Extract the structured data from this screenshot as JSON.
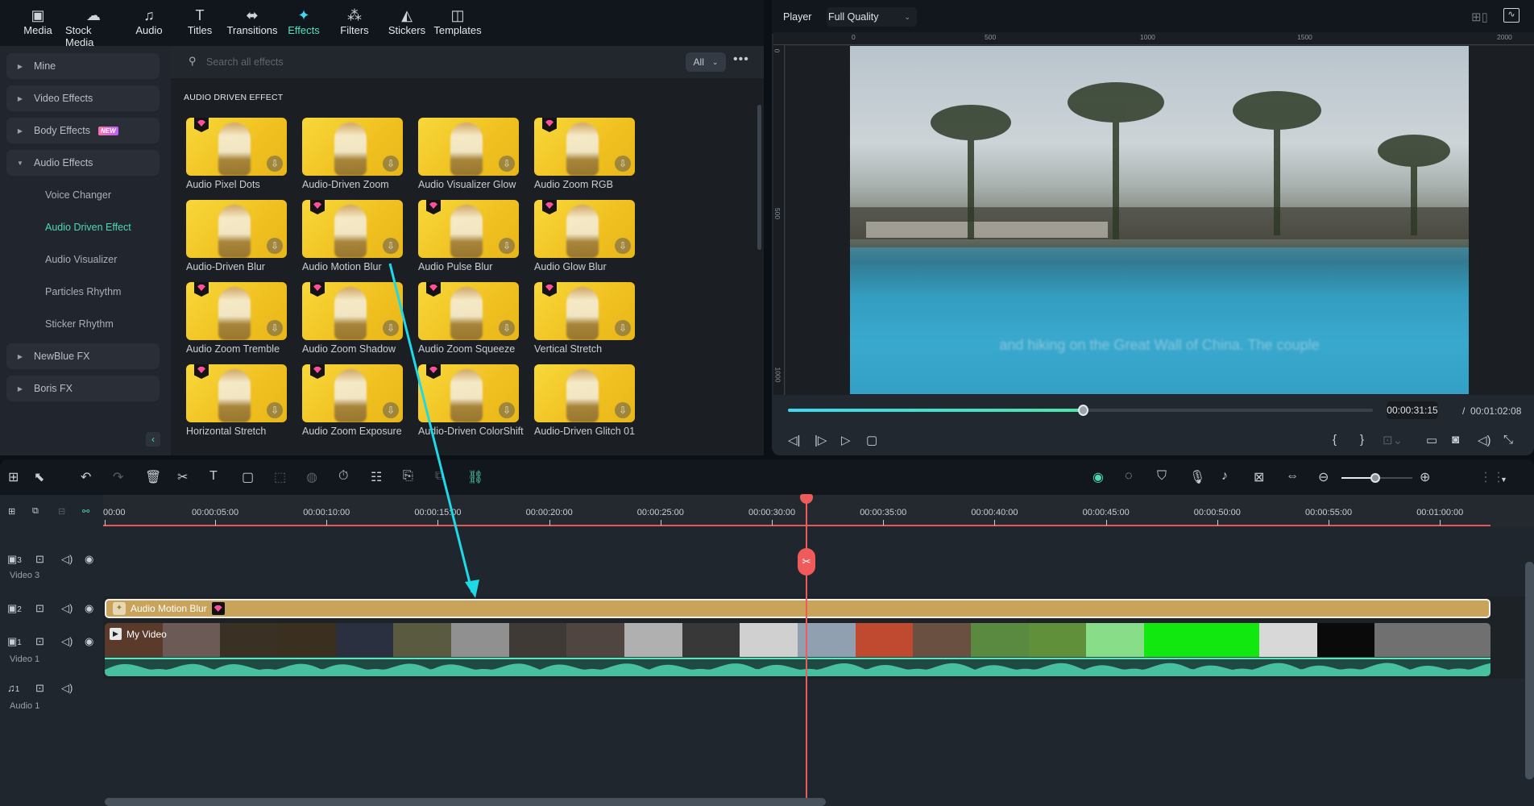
{
  "toolbar": {
    "items": [
      {
        "label": "Media",
        "icon": "media-icon"
      },
      {
        "label": "Stock Media",
        "icon": "stock-media-icon"
      },
      {
        "label": "Audio",
        "icon": "music-note-icon"
      },
      {
        "label": "Titles",
        "icon": "titles-icon"
      },
      {
        "label": "Transitions",
        "icon": "transitions-icon"
      },
      {
        "label": "Effects",
        "icon": "effects-icon",
        "active": true
      },
      {
        "label": "Filters",
        "icon": "filters-icon"
      },
      {
        "label": "Stickers",
        "icon": "stickers-icon"
      },
      {
        "label": "Templates",
        "icon": "templates-icon"
      }
    ]
  },
  "sidebar": {
    "categories": [
      {
        "label": "Mine",
        "expanded": false
      },
      {
        "label": "Video Effects",
        "expanded": false
      },
      {
        "label": "Body Effects",
        "expanded": false,
        "badge": "NEW"
      },
      {
        "label": "Audio Effects",
        "expanded": true
      },
      {
        "label": "NewBlue FX",
        "expanded": false
      },
      {
        "label": "Boris FX",
        "expanded": false
      }
    ],
    "audio_effects_children": [
      {
        "label": "Voice Changer"
      },
      {
        "label": "Audio Driven Effect",
        "active": true
      },
      {
        "label": "Audio Visualizer"
      },
      {
        "label": "Particles Rhythm"
      },
      {
        "label": "Sticker Rhythm"
      }
    ],
    "collapse_icon": "chevron-left-icon"
  },
  "search": {
    "placeholder": "Search all effects",
    "value": "",
    "filter": "All",
    "more_icon": "more-horizontal-icon"
  },
  "effects": {
    "section_title": "AUDIO DRIVEN EFFECT",
    "items": [
      {
        "label": "Audio Pixel Dots",
        "premium": true
      },
      {
        "label": "Audio-Driven Zoom",
        "premium": false
      },
      {
        "label": "Audio Visualizer Glow",
        "premium": false
      },
      {
        "label": "Audio Zoom RGB",
        "premium": true
      },
      {
        "label": "Audio-Driven Blur",
        "premium": false
      },
      {
        "label": "Audio Motion Blur",
        "premium": true
      },
      {
        "label": "Audio Pulse Blur",
        "premium": true
      },
      {
        "label": "Audio Glow Blur",
        "premium": true
      },
      {
        "label": "Audio Zoom Tremble",
        "premium": true
      },
      {
        "label": "Audio Zoom Shadow",
        "premium": true
      },
      {
        "label": "Audio Zoom Squeeze",
        "premium": true
      },
      {
        "label": "Vertical Stretch",
        "premium": true
      },
      {
        "label": "Horizontal Stretch",
        "premium": true
      },
      {
        "label": "Audio Zoom Exposure",
        "premium": true
      },
      {
        "label": "Audio-Driven ColorShift",
        "premium": true
      },
      {
        "label": "Audio-Driven Glitch 01",
        "premium": false
      }
    ]
  },
  "player": {
    "label": "Player",
    "quality": "Full Quality",
    "ruler_h": [
      "0",
      "500",
      "1000",
      "1500",
      "2000"
    ],
    "ruler_v": [
      "0",
      "500",
      "1000"
    ],
    "caption": "and hiking on the Great Wall of China. The couple",
    "progress": 0.505,
    "current_time": "00:00:31:15",
    "separator": "/",
    "total_time": "00:01:02:08"
  },
  "timeline": {
    "ruler_ticks": [
      "00:00",
      "00:00:05:00",
      "00:00:10:00",
      "00:00:15:00",
      "00:00:20:00",
      "00:00:25:00",
      "00:00:30:00",
      "00:00:35:00",
      "00:00:40:00",
      "00:00:45:00",
      "00:00:50:00",
      "00:00:55:00",
      "00:01:00:00"
    ],
    "zoom_level": 0.48,
    "tracks": [
      {
        "id": "3",
        "name": "Video 3",
        "type": "video"
      },
      {
        "id": "2",
        "name": "",
        "type": "video"
      },
      {
        "id": "1",
        "name": "Video 1",
        "type": "video"
      },
      {
        "id": "1",
        "name": "Audio 1",
        "type": "audio"
      }
    ],
    "effect_clip": {
      "label": "Audio Motion Blur",
      "color": "#c9a35a"
    },
    "video_clip": {
      "label": "My Video"
    },
    "playhead_time": "00:00:31:15"
  },
  "colors": {
    "accent": "#4fd8b4",
    "playhead": "#ef5b5b",
    "annotation_arrow": "#1fd8e8"
  }
}
